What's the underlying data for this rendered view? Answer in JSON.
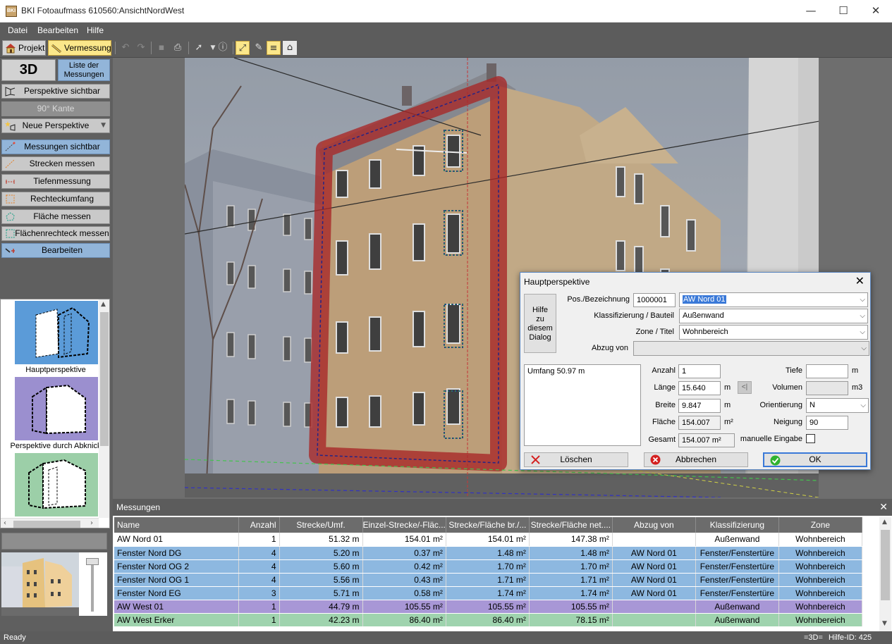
{
  "window": {
    "title": "BKI Fotoaufmass 610560:AnsichtNordWest",
    "app_icon": "BKI",
    "minimize": "—",
    "maximize": "☐",
    "close": "✕"
  },
  "menu": [
    "Datei",
    "Bearbeiten",
    "Hilfe"
  ],
  "toolbar": {
    "projekt": "Projekt",
    "vermessung": "Vermessung",
    "icons": [
      "undo-icon",
      "redo-icon",
      "save-icon",
      "print-icon",
      "pointer-icon",
      "info-icon",
      "measure-line-icon",
      "measure-pen-icon",
      "layers-icon",
      "home-icon"
    ]
  },
  "left_panel": {
    "btn_3d": "3D",
    "btn_liste_line1": "Liste der",
    "btn_liste_line2": "Messungen",
    "buttons": [
      {
        "label": "Perspektive sichtbar",
        "state": "normal"
      },
      {
        "label": "90° Kante",
        "state": "disabled"
      },
      {
        "label": "Neue Perspektive",
        "state": "normal"
      },
      {
        "label": "Messungen sichtbar",
        "state": "active"
      },
      {
        "label": "Strecken messen",
        "state": "normal"
      },
      {
        "label": "Tiefenmessung",
        "state": "normal"
      },
      {
        "label": "Rechteckumfang messen",
        "state": "normal"
      },
      {
        "label": "Fläche messen",
        "state": "normal"
      },
      {
        "label": "Flächenrechteck messen",
        "state": "normal"
      },
      {
        "label": "Bearbeiten",
        "state": "active"
      }
    ],
    "perspectives": [
      {
        "label": "Hauptperspektive",
        "color": "#5b9bd8"
      },
      {
        "label": "Perspektive durch Abknick",
        "color": "#9b8fcf"
      },
      {
        "label": "",
        "color": "#9ccfa8"
      }
    ]
  },
  "dialog": {
    "title": "Hauptperspektive",
    "help_line1": "Hilfe",
    "help_line2": "zu",
    "help_line3": "diesem",
    "help_line4": "Dialog",
    "pos_label": "Pos./Bezeichnung",
    "pos_value": "1000001",
    "name_value": "AW Nord 01",
    "klass_label": "Klassifizierung / Bauteil",
    "klass_value": "Außenwand",
    "zone_label": "Zone / Titel",
    "zone_value": "Wohnbereich",
    "abzug_label": "Abzug von",
    "abzug_value": "",
    "summary": "Umfang 50.97 m",
    "anzahl_label": "Anzahl",
    "anzahl_value": "1",
    "laenge_label": "Länge",
    "laenge_value": "15.640",
    "laenge_unit": "m",
    "breite_label": "Breite",
    "breite_value": "9.847",
    "breite_unit": "m",
    "flaeche_label": "Fläche",
    "flaeche_value": "154.007",
    "flaeche_unit": "m²",
    "gesamt_label": "Gesamt",
    "gesamt_value": "154.007 m²",
    "tiefe_label": "Tiefe",
    "tiefe_value": "",
    "tiefe_unit": "m",
    "volumen_label": "Volumen",
    "volumen_value": "",
    "volumen_unit": "m3",
    "orient_label": "Orientierung",
    "orient_value": "N",
    "neigung_label": "Neigung",
    "neigung_value": "90",
    "manuell_label": "manuelle Eingabe",
    "manuell_checked": false,
    "arrow_btn": "<|",
    "loeschen": "Löschen",
    "abbrechen": "Abbrechen",
    "ok": "OK"
  },
  "messungen": {
    "title": "Messungen",
    "close": "✕",
    "columns": [
      "Name",
      "Anzahl",
      "Strecke/Umf.",
      "Einzel-Strecke/-Fläc...",
      "Strecke/Fläche br./...",
      "Strecke/Fläche net....",
      "Abzug von",
      "Klassifizierung",
      "Zone"
    ],
    "rows": [
      {
        "name": "AW Nord 01",
        "anzahl": "1",
        "strecke": "51.32 m",
        "einzel": "154.01 m²",
        "brutto": "154.01 m²",
        "netto": "147.38 m²",
        "abzug": "",
        "klass": "Außenwand",
        "zone": "Wohnbereich",
        "color": "#ffffff"
      },
      {
        "name": "Fenster Nord DG",
        "anzahl": "4",
        "strecke": "5.20 m",
        "einzel": "0.37 m²",
        "brutto": "1.48 m²",
        "netto": "1.48 m²",
        "abzug": "AW Nord 01",
        "klass": "Fenster/Fenstertüre",
        "zone": "Wohnbereich",
        "color": "#8db8e0"
      },
      {
        "name": "Fenster Nord OG 2",
        "anzahl": "4",
        "strecke": "5.60 m",
        "einzel": "0.42 m²",
        "brutto": "1.70 m²",
        "netto": "1.70 m²",
        "abzug": "AW Nord 01",
        "klass": "Fenster/Fenstertüre",
        "zone": "Wohnbereich",
        "color": "#8db8e0"
      },
      {
        "name": "Fenster Nord OG 1",
        "anzahl": "4",
        "strecke": "5.56 m",
        "einzel": "0.43 m²",
        "brutto": "1.71 m²",
        "netto": "1.71 m²",
        "abzug": "AW Nord 01",
        "klass": "Fenster/Fenstertüre",
        "zone": "Wohnbereich",
        "color": "#8db8e0"
      },
      {
        "name": "Fenster Nord EG",
        "anzahl": "3",
        "strecke": "5.71 m",
        "einzel": "0.58 m²",
        "brutto": "1.74 m²",
        "netto": "1.74 m²",
        "abzug": "AW Nord 01",
        "klass": "Fenster/Fenstertüre",
        "zone": "Wohnbereich",
        "color": "#8db8e0"
      },
      {
        "name": "AW West 01",
        "anzahl": "1",
        "strecke": "44.79 m",
        "einzel": "105.55 m²",
        "brutto": "105.55 m²",
        "netto": "105.55 m²",
        "abzug": "",
        "klass": "Außenwand",
        "zone": "Wohnbereich",
        "color": "#a897d6"
      },
      {
        "name": "AW West Erker",
        "anzahl": "1",
        "strecke": "42.23 m",
        "einzel": "86.40 m²",
        "brutto": "86.40 m²",
        "netto": "78.15 m²",
        "abzug": "",
        "klass": "Außenwand",
        "zone": "Wohnbereich",
        "color": "#9fd3ae"
      }
    ]
  },
  "status": {
    "text": "Ready",
    "mode": "=3D=",
    "help_id": "Hilfe-ID: 425"
  }
}
